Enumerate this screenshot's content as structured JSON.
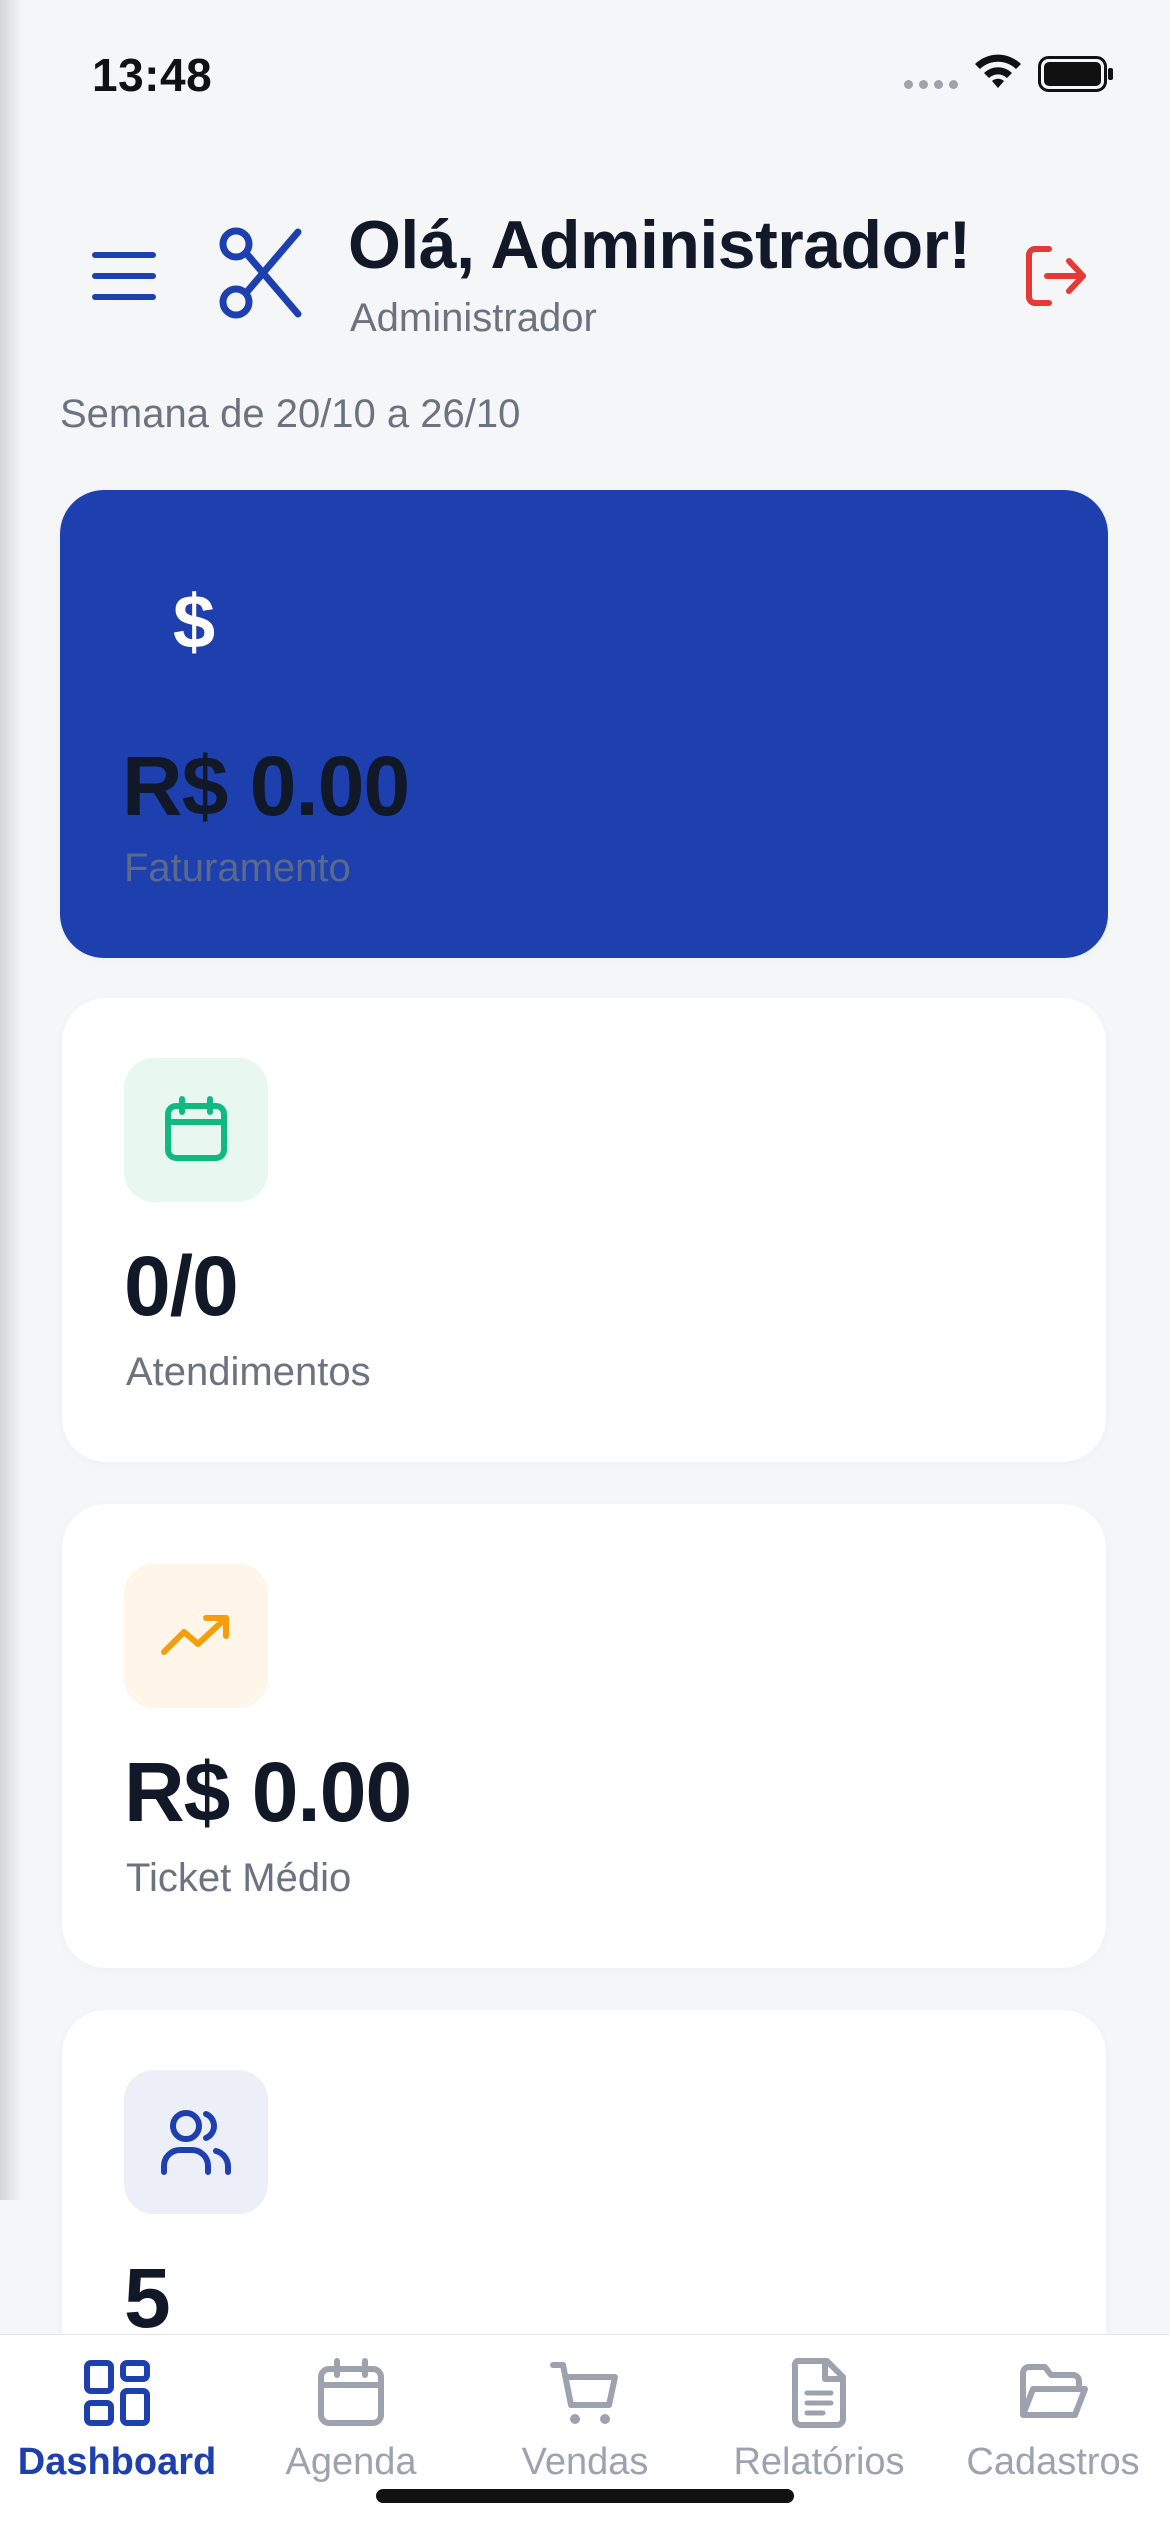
{
  "status_bar": {
    "time": "13:48"
  },
  "header": {
    "greeting": "Olá, Administrador!",
    "role": "Administrador",
    "menu_icon": "hamburger-menu-icon",
    "logo_icon": "scissors-icon",
    "logout_icon": "logout-icon"
  },
  "week_label": "Semana de 20/10 a 26/10",
  "cards": {
    "revenue": {
      "value": "R$ 0.00",
      "label": "Faturamento",
      "icon": "dollar-icon",
      "bg": "#1e3fae"
    },
    "appointments": {
      "value": "0/0",
      "label": "Atendimentos",
      "icon": "calendar-icon",
      "icon_bg": "#e8f8f1",
      "icon_color": "#10b981"
    },
    "ticket": {
      "value": "R$ 0.00",
      "label": "Ticket Médio",
      "icon": "trending-up-icon",
      "icon_bg": "#fff5e8",
      "icon_color": "#f59e0b"
    },
    "clients": {
      "value": "5",
      "icon": "users-icon",
      "icon_bg": "#eceff8",
      "icon_color": "#1e40af"
    }
  },
  "tab_bar": {
    "tabs": [
      {
        "label": "Dashboard",
        "icon": "dashboard-icon",
        "active": true
      },
      {
        "label": "Agenda",
        "icon": "calendar-icon",
        "active": false
      },
      {
        "label": "Vendas",
        "icon": "cart-icon",
        "active": false
      },
      {
        "label": "Relatórios",
        "icon": "document-icon",
        "active": false
      },
      {
        "label": "Cadastros",
        "icon": "folder-icon",
        "active": false
      }
    ]
  },
  "colors": {
    "primary": "#1e40af",
    "danger": "#e53935",
    "muted": "#6b7280",
    "inactive": "#9ca3af"
  }
}
